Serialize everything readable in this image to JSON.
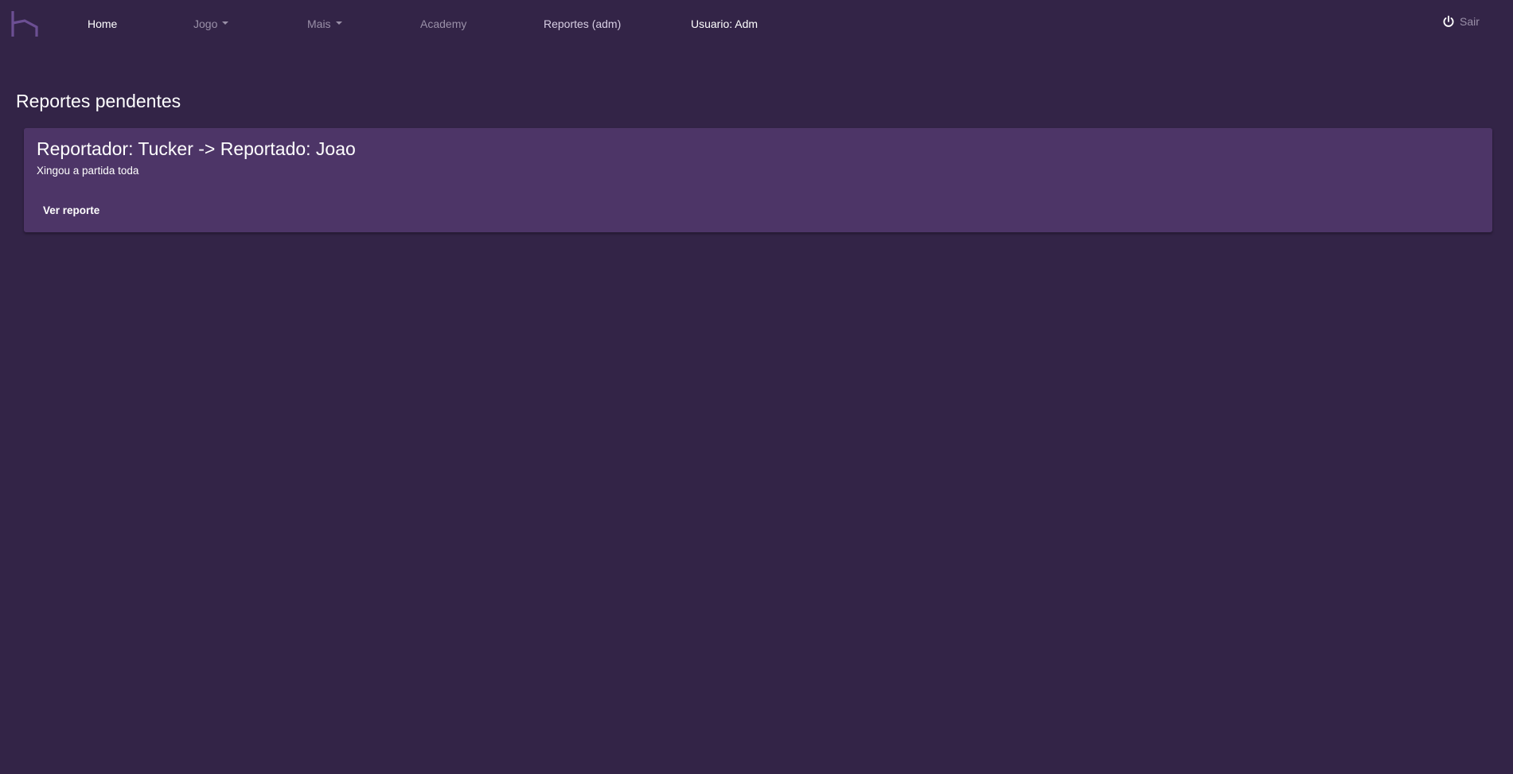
{
  "nav": {
    "items": [
      {
        "label": "Home",
        "style": "bright",
        "dropdown": false
      },
      {
        "label": "Jogo",
        "style": "muted",
        "dropdown": true
      },
      {
        "label": "Mais",
        "style": "muted",
        "dropdown": true
      },
      {
        "label": "Academy",
        "style": "muted",
        "dropdown": false
      },
      {
        "label": "Reportes (adm)",
        "style": "muted-light",
        "dropdown": false
      }
    ],
    "user_label": "Usuario: Adm",
    "logout_label": "Sair",
    "logo_icon": "logo-icon",
    "logout_icon": "power-icon"
  },
  "main": {
    "title": "Reportes pendentes",
    "reports": [
      {
        "title": "Reportador: Tucker -> Reportado: Joao",
        "text": "Xingou a partida toda",
        "button_label": "Ver reporte"
      }
    ]
  },
  "colors": {
    "background": "#332447",
    "card": "#4d3567",
    "muted_text": "#9a90a8",
    "logo": "#6c4f93"
  }
}
